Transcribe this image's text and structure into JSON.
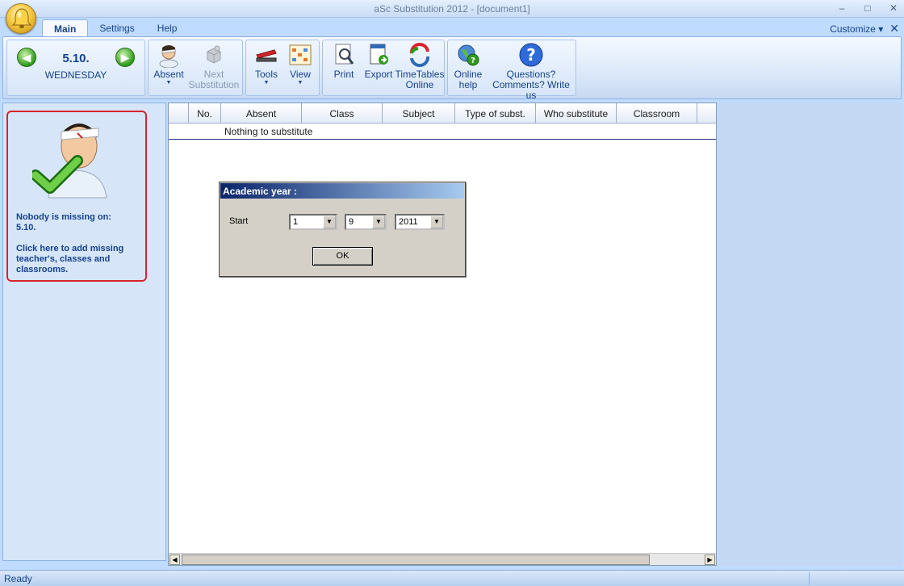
{
  "window": {
    "title": "aSc Substitution 2012  - [document1]",
    "min": "–",
    "max": "□",
    "close": "✕"
  },
  "tabs": [
    {
      "label": "Main"
    },
    {
      "label": "Settings"
    },
    {
      "label": "Help"
    }
  ],
  "customize": {
    "label": "Customize ▾",
    "close": "✕"
  },
  "ribbon": {
    "date": "5.10.",
    "day": "WEDNESDAY",
    "absent": "Absent",
    "next_line1": "Next",
    "next_line2": "Substitution",
    "tools": "Tools",
    "view": "View",
    "print": "Print",
    "export": "Export",
    "timetables_line1": "TimeTables",
    "timetables_line2": "Online",
    "online_help_line1": "Online",
    "online_help_line2": "help",
    "questions_line1": "Questions?",
    "questions_line2": "Comments? Write us"
  },
  "left_panel": {
    "missing_line1": "Nobody is missing on:",
    "missing_date": "5.10.",
    "add_text": "Click here to add missing teacher's, classes and classrooms."
  },
  "grid": {
    "columns": [
      "",
      "No.",
      "Absent",
      "Class",
      "Subject",
      "Type of subst.",
      "Who substitute",
      "Classroom",
      ""
    ],
    "empty_text": "Nothing to substitute"
  },
  "dialog": {
    "title": "Academic year :",
    "start_label": "Start",
    "day_value": "1",
    "month_value": "9",
    "year_value": "2011",
    "ok_label": "OK"
  },
  "status": {
    "text": "Ready"
  }
}
